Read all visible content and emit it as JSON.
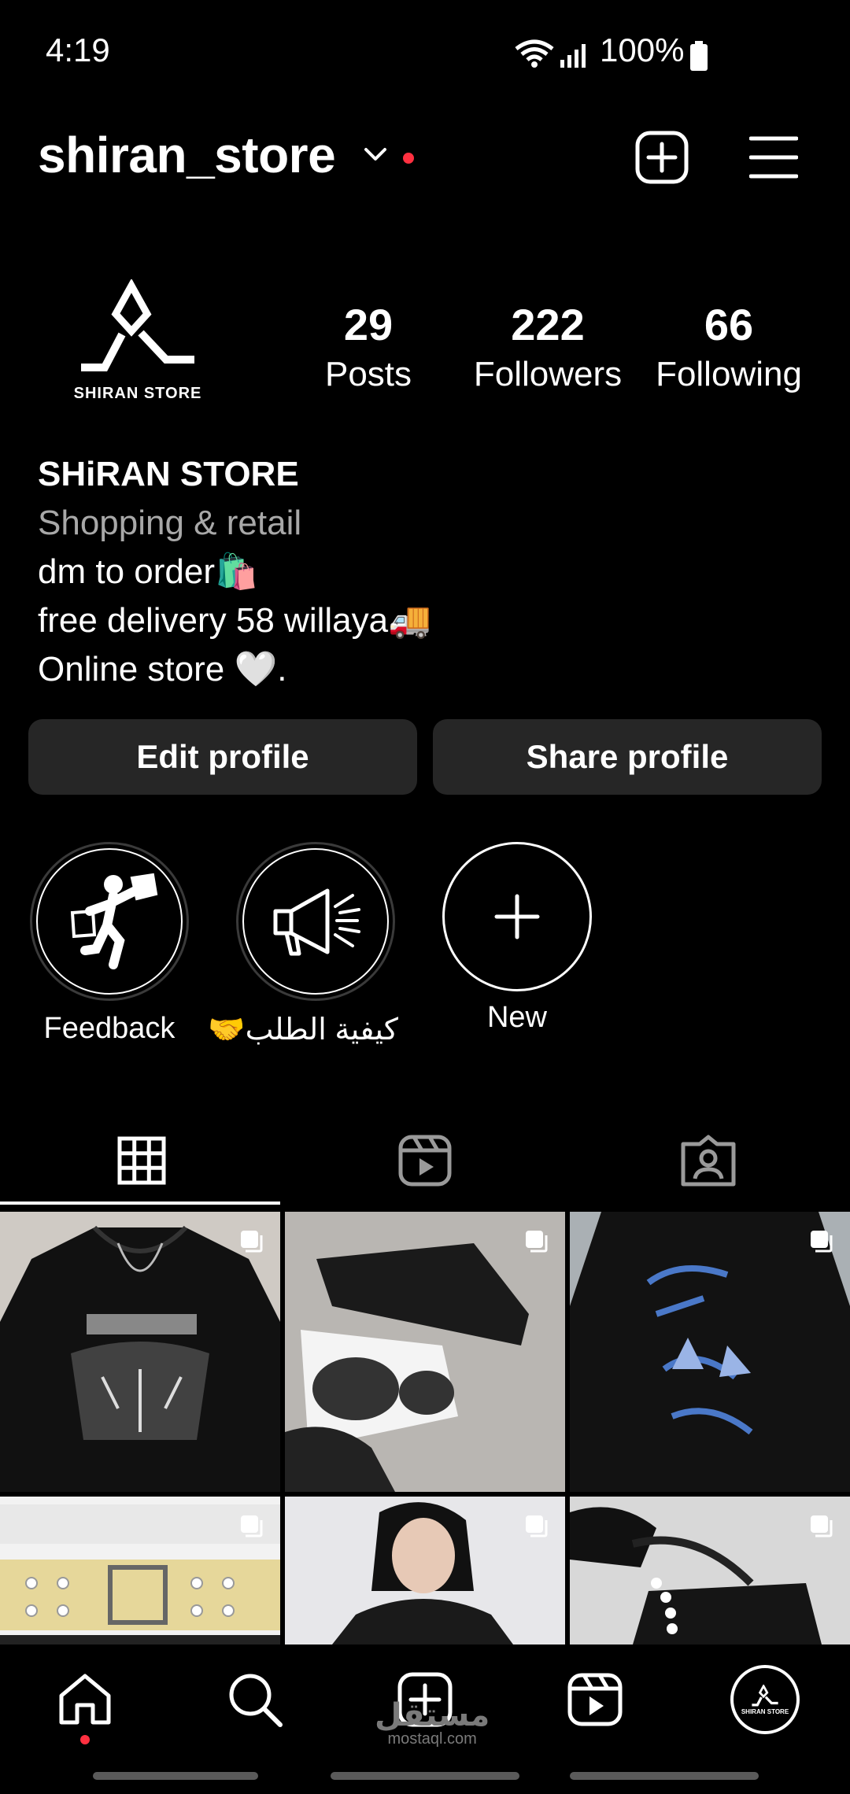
{
  "status": {
    "time": "4:19",
    "battery": "100%"
  },
  "header": {
    "username": "shiran_store"
  },
  "profile": {
    "avatar_text": "SHIRAN STORE",
    "stats": [
      {
        "value": "29",
        "label": "Posts"
      },
      {
        "value": "222",
        "label": "Followers"
      },
      {
        "value": "66",
        "label": "Following"
      }
    ],
    "bio": {
      "name": "SHiRAN STORE",
      "category": "Shopping & retail",
      "line1": "dm to order🛍️",
      "line2": "free delivery 58 willaya🚚",
      "line3": "Online store 🤍."
    }
  },
  "buttons": {
    "edit": "Edit profile",
    "share": "Share profile"
  },
  "highlights": [
    {
      "label": "Feedback"
    },
    {
      "label": "كيفية الطلب🤝"
    },
    {
      "label": "New"
    }
  ],
  "watermark": {
    "arabic": "مستقل",
    "latin": "mostaql.com"
  },
  "colors": {
    "background": "#000000",
    "button": "#262626",
    "notification": "#ff3040",
    "secondary_text": "#a8a8a8"
  }
}
